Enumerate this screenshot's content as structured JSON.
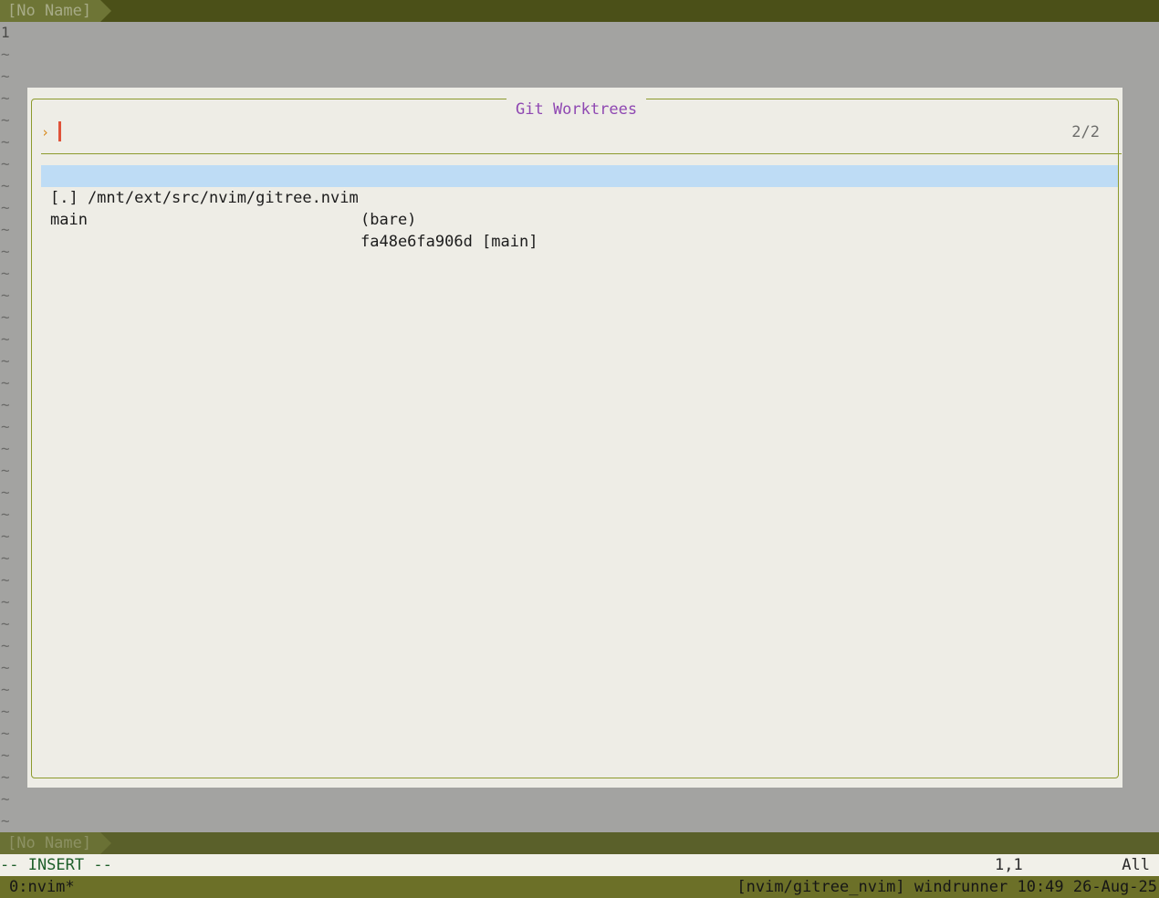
{
  "tabline": {
    "active_tab": "[No Name]"
  },
  "editor": {
    "first_line_number": "1",
    "tilde": "~"
  },
  "picker": {
    "title": "Git Worktrees",
    "prompt_icon": "›",
    "query": "",
    "match_count": "2/2",
    "results": [
      {
        "name": "[.] /mnt/ext/src/nvim/gitree.nvim",
        "detail": "(bare)",
        "selected": true
      },
      {
        "name": "main",
        "detail": "fa48e6fa906d [main]",
        "selected": false
      }
    ]
  },
  "statusline": {
    "file_name": "[No Name]"
  },
  "cmdline": {
    "mode": "-- INSERT --",
    "position": "1,1",
    "scroll": "All"
  },
  "tmux": {
    "window": "0:nvim*",
    "status": "[nvim/gitree_nvim] windrunner 10:49 26-Aug-25"
  },
  "colors": {
    "accent_border": "#8c9a2c",
    "title": "#8f48b2",
    "selection": "#bedcf5",
    "cursor": "#e0533a"
  }
}
